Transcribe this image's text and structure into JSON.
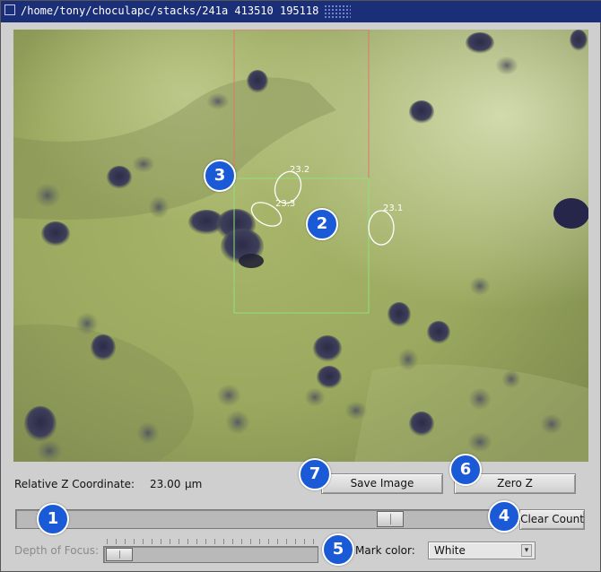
{
  "window": {
    "title": "/home/tony/choculapc/stacks/241a 413510 195118"
  },
  "image": {
    "mark_labels": [
      "23.2",
      "23.3",
      "23.1"
    ]
  },
  "controls": {
    "z_label": "Relative Z Coordinate:",
    "z_value": "23.00",
    "z_unit": "µm",
    "save_image": "Save Image",
    "zero_z": "Zero Z",
    "clear_count": "Clear Count",
    "depth_of_focus_label": "Depth of Focus:",
    "mark_color_label": "Mark color:",
    "mark_color_value": "White"
  },
  "annotations": [
    "1",
    "2",
    "3",
    "4",
    "5",
    "6",
    "7"
  ],
  "colors": {
    "titlebar": "#1a2f78",
    "badge": "#1a5ad6",
    "roi_red": "#e0786a",
    "roi_green": "#8fe07a"
  }
}
